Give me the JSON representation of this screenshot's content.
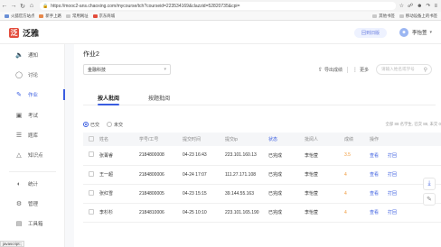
{
  "browser": {
    "url": "https://mooc2-ans.chaoxing.com/mycourse/tch?courseid=223534169&clazzid=52820735&cpi=",
    "bookmarks": [
      "火狐官方站点",
      "新手上路",
      "常用网址",
      "京东商城"
    ],
    "bookmarks_right": [
      "其他书签",
      "移动设备上的书签"
    ]
  },
  "app": {
    "logo_mark": "泛",
    "logo_text": "泛雅",
    "return_label": "回到旧版",
    "user_name": "李怡萱"
  },
  "sidebar": {
    "items": [
      {
        "label": "通知",
        "icon": "speaker-icon"
      },
      {
        "label": "讨论",
        "icon": "chat-icon"
      },
      {
        "label": "作业",
        "icon": "edit-icon"
      },
      {
        "label": "考试",
        "icon": "exam-icon"
      },
      {
        "label": "题库",
        "icon": "stack-icon"
      },
      {
        "label": "知识点",
        "icon": "knowledge-icon"
      },
      {
        "label": "统计",
        "icon": "stats-icon"
      },
      {
        "label": "管理",
        "icon": "gear-icon"
      },
      {
        "label": "工具箱",
        "icon": "toolbox-icon"
      }
    ],
    "active": "作业"
  },
  "main": {
    "title": "作业2",
    "course_select": "金融科技",
    "export_label": "导出成绩",
    "more_label": "更多",
    "search_placeholder": "请输入姓名或学号",
    "tabs": [
      "按人批阅",
      "按题批阅"
    ],
    "filters": [
      "已交",
      "未交"
    ],
    "summary": "全部 88 名学生, 已交 88, 未交 0",
    "columns": [
      "姓名",
      "学号/工号",
      "提交时间",
      "提交ip",
      "状态",
      "批阅人",
      "成绩",
      "操作"
    ],
    "rows": [
      {
        "name": "张菁睿",
        "id": "2184800008",
        "time": "04-23 16:43",
        "ip": "223.101.160.13",
        "status": "已完成",
        "grader": "李怡萱",
        "score": "3.5",
        "op1": "查看",
        "op2": "打回"
      },
      {
        "name": "王一超",
        "id": "2184800006",
        "time": "04-24 17:07",
        "ip": "111.27.171.108",
        "status": "已完成",
        "grader": "李怡萱",
        "score": "4",
        "op1": "查看",
        "op2": "打回"
      },
      {
        "name": "张红雪",
        "id": "2184800005",
        "time": "04-23 15:15",
        "ip": "39.144.55.163",
        "status": "已完成",
        "grader": "李怡萱",
        "score": "4",
        "op1": "查看",
        "op2": "打回"
      },
      {
        "name": "李杉杉",
        "id": "2184810006",
        "time": "04-25 10:10",
        "ip": "223.101.165.190",
        "status": "已完成",
        "grader": "李怡萱",
        "score": "4",
        "op1": "查看",
        "op2": "打回"
      }
    ]
  },
  "status_bar": "javascript:;"
}
